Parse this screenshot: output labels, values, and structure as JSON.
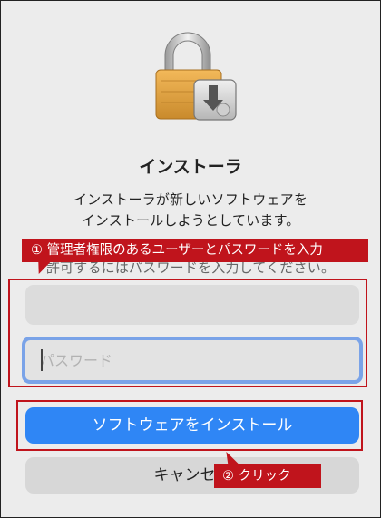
{
  "dialog": {
    "title": "インストーラ",
    "message_line1": "インストーラが新しいソフトウェアを",
    "message_line2": "インストールしようとしています。",
    "message_line3_partial": "許可するにはパスワードを入力してください。"
  },
  "fields": {
    "username_value": "",
    "password_placeholder": "パスワード"
  },
  "buttons": {
    "install_label": "ソフトウェアをインストール",
    "cancel_label": "キャンセル"
  },
  "annotations": {
    "step1": "① 管理者権限のあるユーザーとパスワードを入力",
    "step2": "② クリック"
  },
  "icons": {
    "app_icon": "installer-lock-icon"
  },
  "colors": {
    "accent": "#2f86f5",
    "annotation": "#c0141c",
    "focus_ring": "#7aa3e8"
  }
}
